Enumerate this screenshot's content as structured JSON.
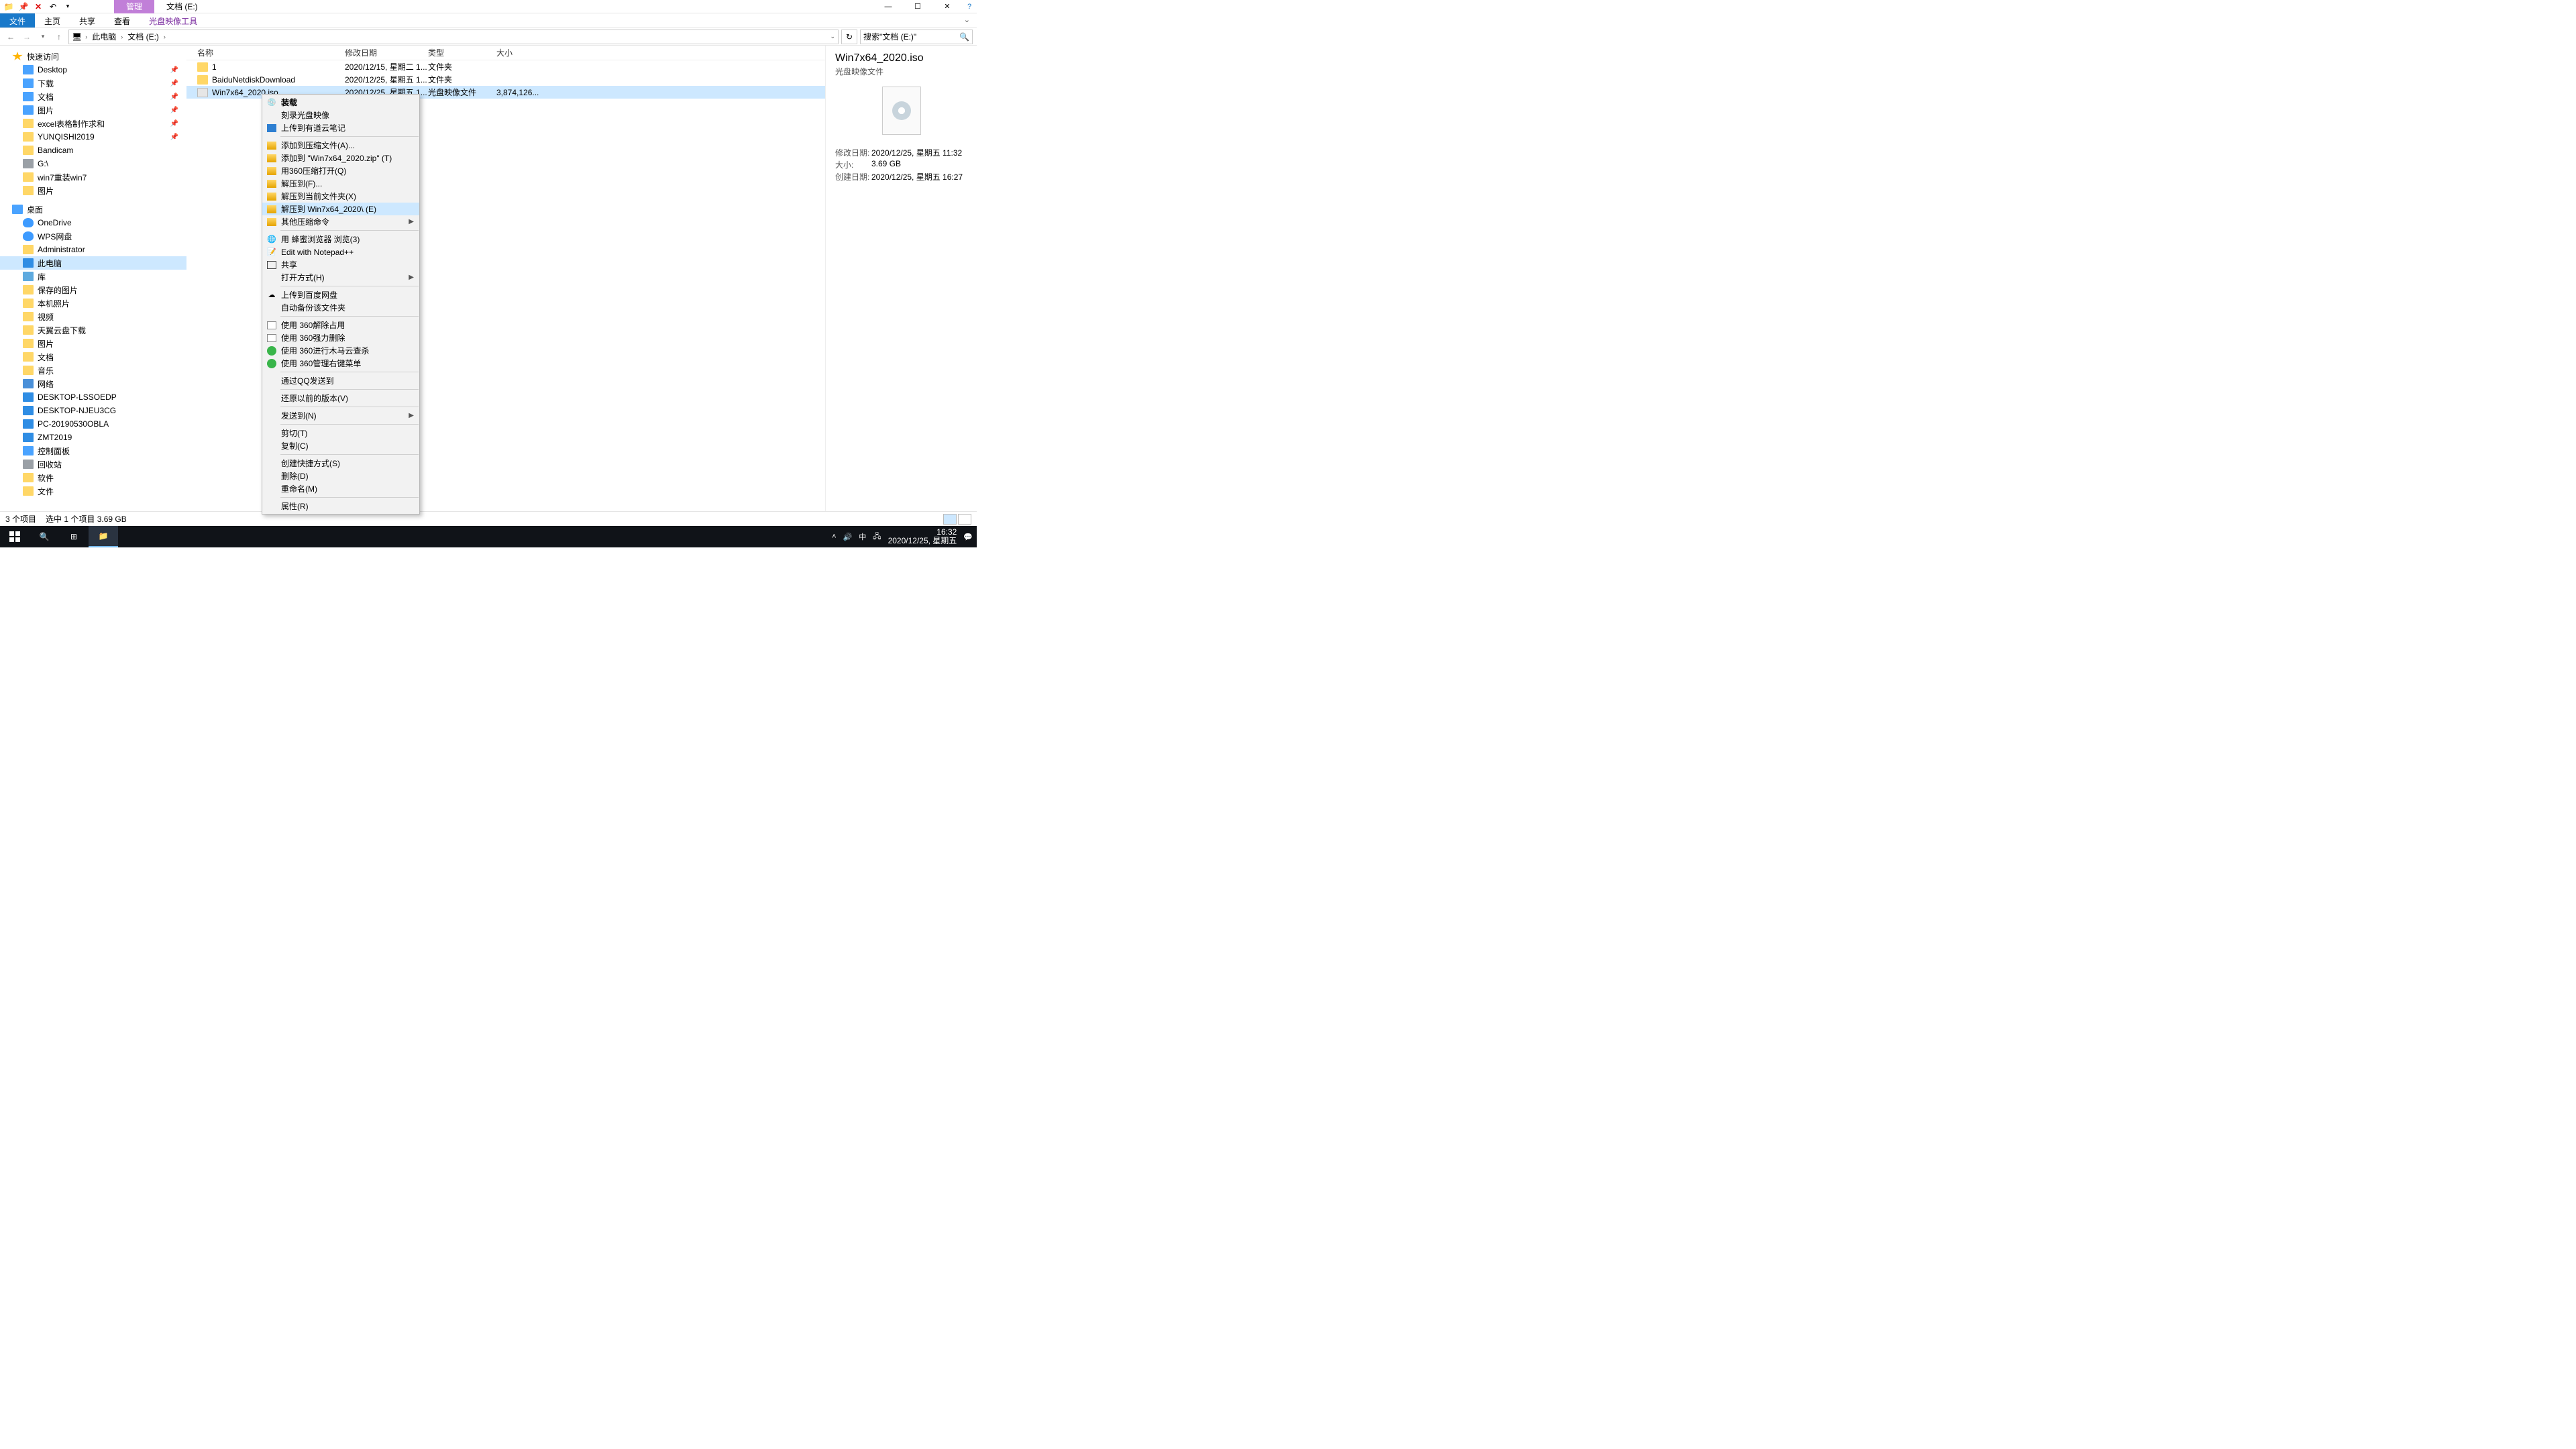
{
  "title_context": "管理",
  "title_location": "文档 (E:)",
  "ribbon": {
    "file": "文件",
    "home": "主页",
    "share": "共享",
    "view": "查看",
    "disc_tools": "光盘映像工具"
  },
  "address": {
    "root": "此电脑",
    "seg": "文档 (E:)"
  },
  "search_placeholder": "搜索\"文档 (E:)\"",
  "nav": {
    "quick": "快速访问",
    "desktop": "Desktop",
    "downloads": "下载",
    "documents": "文档",
    "pictures": "图片",
    "excel": "excel表格制作求和",
    "yunqishi": "YUNQISHI2019",
    "bandicam": "Bandicam",
    "gdrive": "G:\\",
    "win7reinstall": "win7重装win7",
    "pictures2": "图片",
    "desktop_root": "桌面",
    "onedrive": "OneDrive",
    "wps": "WPS网盘",
    "admin": "Administrator",
    "thispc": "此电脑",
    "libraries": "库",
    "saved_pics": "保存的图片",
    "local_pics": "本机照片",
    "videos": "视频",
    "tianyi": "天翼云盘下载",
    "pics3": "图片",
    "docs2": "文档",
    "music": "音乐",
    "network": "网络",
    "pc1": "DESKTOP-LSSOEDP",
    "pc2": "DESKTOP-NJEU3CG",
    "pc3": "PC-20190530OBLA",
    "pc4": "ZMT2019",
    "control": "控制面板",
    "recycle": "回收站",
    "software": "软件",
    "files": "文件"
  },
  "cols": {
    "name": "名称",
    "date": "修改日期",
    "type": "类型",
    "size": "大小"
  },
  "rows": [
    {
      "name": "1",
      "date": "2020/12/15, 星期二 1...",
      "type": "文件夹",
      "size": ""
    },
    {
      "name": "BaiduNetdiskDownload",
      "date": "2020/12/25, 星期五 1...",
      "type": "文件夹",
      "size": ""
    },
    {
      "name": "Win7x64_2020.iso",
      "date": "2020/12/25, 星期五 1...",
      "type": "光盘映像文件",
      "size": "3,874,126..."
    }
  ],
  "preview": {
    "title": "Win7x64_2020.iso",
    "sub": "光盘映像文件",
    "modified_k": "修改日期:",
    "modified_v": "2020/12/25, 星期五 11:32",
    "size_k": "大小:",
    "size_v": "3.69 GB",
    "created_k": "创建日期:",
    "created_v": "2020/12/25, 星期五 16:27"
  },
  "status": {
    "count": "3 个项目",
    "sel": "选中 1 个项目  3.69 GB"
  },
  "ctx": {
    "mount": "装载",
    "burn": "刻录光盘映像",
    "youdao": "上传到有道云笔记",
    "addarchive": "添加到压缩文件(A)...",
    "addzip": "添加到 \"Win7x64_2020.zip\" (T)",
    "open360": "用360压缩打开(Q)",
    "extractto": "解压到(F)...",
    "extracthere": "解压到当前文件夹(X)",
    "extractfolder": "解压到 Win7x64_2020\\ (E)",
    "othercomp": "其他压缩命令",
    "browser": "用 蜂蜜浏览器 浏览(3)",
    "npp": "Edit with Notepad++",
    "share": "共享",
    "openwith": "打开方式(H)",
    "baidu": "上传到百度网盘",
    "autobak": "自动备份该文件夹",
    "unlock": "使用 360解除占用",
    "forcedel": "使用 360强力删除",
    "trojan": "使用 360进行木马云查杀",
    "mgr": "使用 360管理右键菜单",
    "qq": "通过QQ发送到",
    "restore": "还原以前的版本(V)",
    "sendto": "发送到(N)",
    "cut": "剪切(T)",
    "copy": "复制(C)",
    "shortcut": "创建快捷方式(S)",
    "delete": "删除(D)",
    "rename": "重命名(M)",
    "props": "属性(R)"
  },
  "taskbar": {
    "ime": "中",
    "time": "16:32",
    "date": "2020/12/25, 星期五"
  }
}
